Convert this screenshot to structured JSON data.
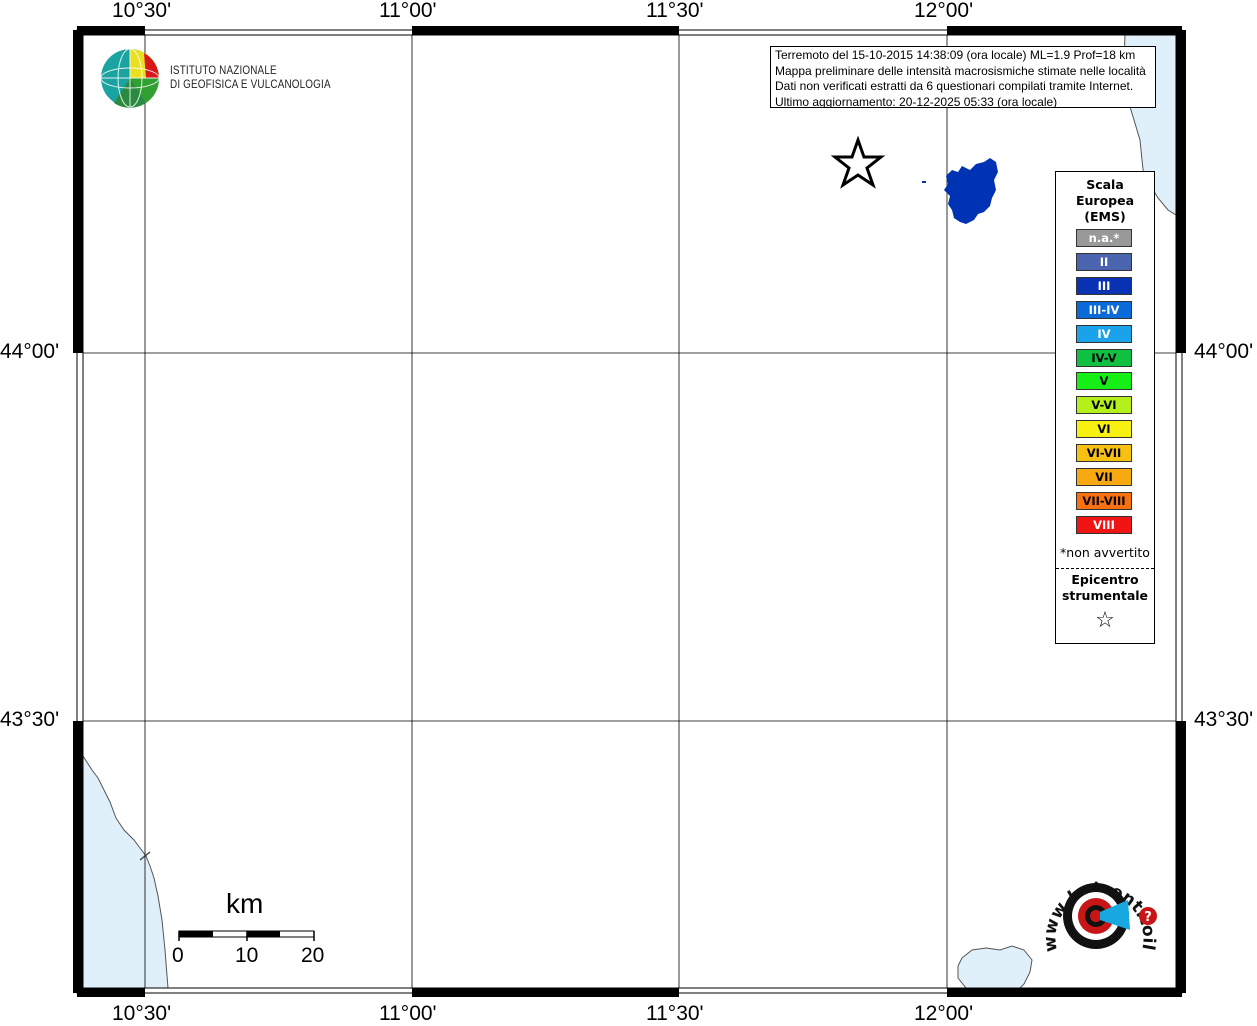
{
  "map": {
    "top_lon_labels": [
      "10°30'",
      "11°00'",
      "11°30'",
      "12°00'"
    ],
    "bottom_lon_labels": [
      "10°30'",
      "11°00'",
      "11°30'",
      "12°00'"
    ],
    "left_lat_labels": [
      "44°00'",
      "43°30'"
    ],
    "right_lat_labels": [
      "44°00'",
      "43°30'"
    ],
    "colors": {
      "sea": "#e0f0fb",
      "coast": "#555555",
      "grid": "#000000",
      "intensity_III": "#0033b3"
    }
  },
  "institute": {
    "line1": "ISTITUTO NAZIONALE",
    "line2": "DI GEOFISICA E VULCANOLOGIA"
  },
  "info": {
    "line1": "Terremoto del 15-10-2015 14:38:09 (ora locale) ML=1.9 Prof=18 km",
    "line2": "Mappa preliminare delle intensità macrosismiche stimate nelle località",
    "line3": "Dati non verificati estratti da 6 questionari compilati tramite Internet.",
    "line4": "Ultimo aggiornamento: 20-12-2025 05:33 (ora locale)"
  },
  "legend": {
    "title1": "Scala",
    "title2": "Europea",
    "title3": "(EMS)",
    "items": [
      {
        "label": "n.a.*",
        "color": "#999999",
        "dark": false
      },
      {
        "label": "II",
        "color": "#4a64b0",
        "dark": false
      },
      {
        "label": "III",
        "color": "#0a32b4",
        "dark": false
      },
      {
        "label": "III-IV",
        "color": "#0a6ad8",
        "dark": false
      },
      {
        "label": "IV",
        "color": "#1aa3ea",
        "dark": false
      },
      {
        "label": "IV-V",
        "color": "#10c040",
        "dark": true
      },
      {
        "label": "V",
        "color": "#16ef16",
        "dark": true
      },
      {
        "label": "V-VI",
        "color": "#b4f01a",
        "dark": true
      },
      {
        "label": "VI",
        "color": "#f8f010",
        "dark": true
      },
      {
        "label": "VI-VII",
        "color": "#f8c010",
        "dark": true
      },
      {
        "label": "VII",
        "color": "#f8a810",
        "dark": true
      },
      {
        "label": "VII-VIII",
        "color": "#f87010",
        "dark": true
      },
      {
        "label": "VIII",
        "color": "#f01414",
        "dark": false
      }
    ],
    "note": "*non avvertito",
    "epi1": "Epicentro",
    "epi2": "strumentale",
    "star": "☆"
  },
  "scale": {
    "unit": "km",
    "labels": [
      "0",
      "10",
      "20"
    ]
  },
  "brand": {
    "text": "www.haisentitoilterremoto.it",
    "q": "?"
  }
}
